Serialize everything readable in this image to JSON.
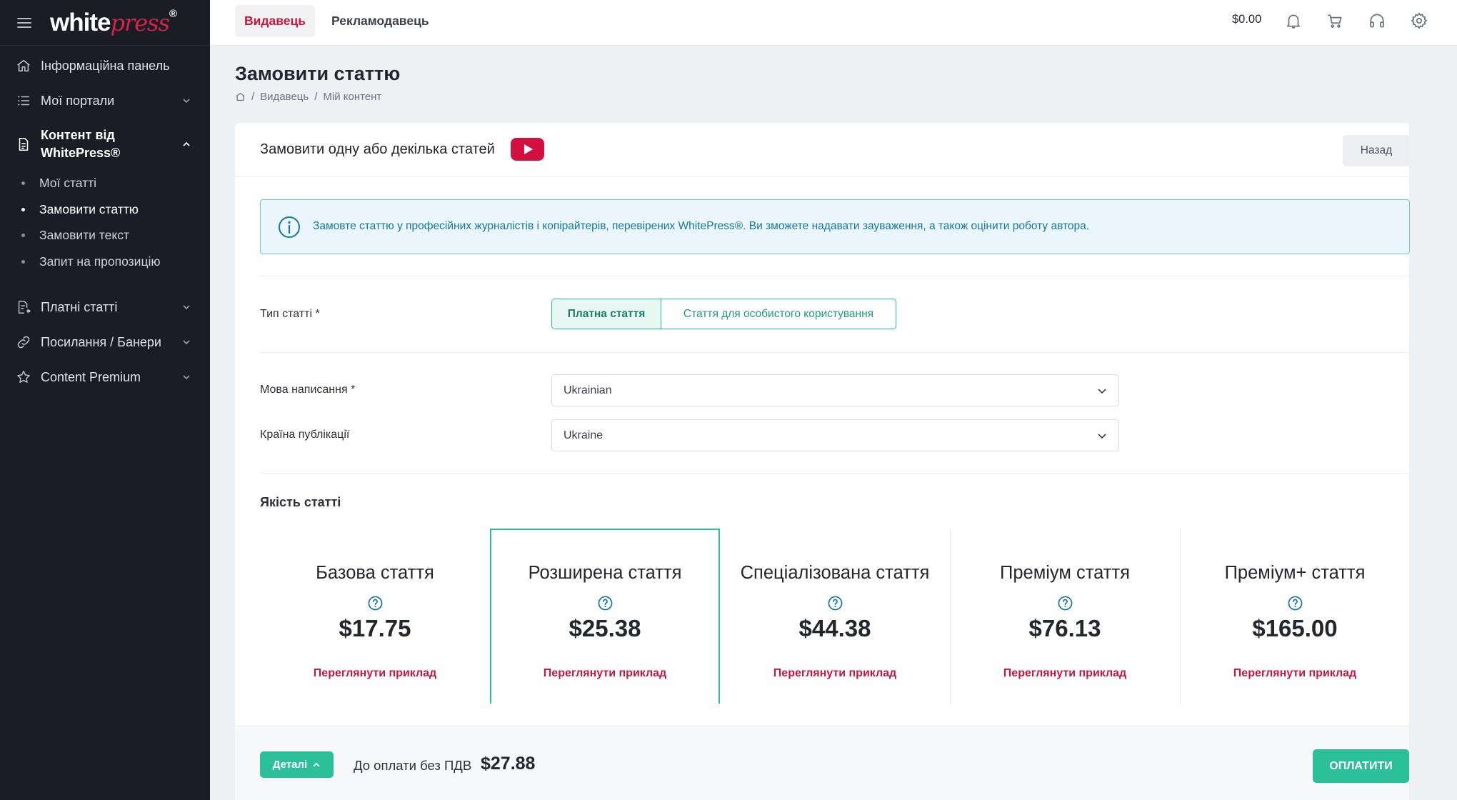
{
  "brand": {
    "white": "white",
    "press": "press",
    "reg": "®"
  },
  "sidebar": {
    "items": [
      {
        "label": "Інформаційна панель",
        "icon": "home-icon"
      },
      {
        "label": "Мої портали",
        "icon": "list-icon"
      },
      {
        "label": "Контент від WhitePress®",
        "icon": "document-icon"
      },
      {
        "label": "Платні статті",
        "icon": "paid-articles-icon"
      },
      {
        "label": "Посилання / Банери",
        "icon": "link-icon"
      },
      {
        "label": "Content Premium",
        "icon": "star-icon"
      }
    ],
    "subitems": [
      "Мої статті",
      "Замовити статтю",
      "Замовити текст",
      "Запит на пропозицію"
    ]
  },
  "topbar": {
    "tab_publisher": "Видавець",
    "tab_advertiser": "Рекламодавець",
    "balance": "$0.00"
  },
  "page": {
    "title": "Замовити статтю",
    "breadcrumb": [
      "Видавець",
      "Мій контент"
    ]
  },
  "card": {
    "title": "Замовити одну або декілька статей",
    "back": "Назад",
    "info": "Замовте статтю у професійних журналістів і копірайтерів, перевірених WhitePress®. Ви зможете надавати зауваження, а також оцінити роботу автора."
  },
  "form": {
    "type_label": "Тип статті *",
    "type_options": [
      "Платна стаття",
      "Стаття для особистого користування"
    ],
    "lang_label": "Мова написання *",
    "lang_value": "Ukrainian",
    "country_label": "Країна публікації",
    "country_value": "Ukraine"
  },
  "quality": {
    "label": "Якість статті",
    "options": [
      {
        "name": "Базова стаття",
        "price": "$17.75",
        "link": "Переглянути приклад"
      },
      {
        "name": "Розширена стаття",
        "price": "$25.38",
        "link": "Переглянути приклад"
      },
      {
        "name": "Спеціалізована стаття",
        "price": "$44.38",
        "link": "Переглянути приклад"
      },
      {
        "name": "Преміум стаття",
        "price": "$76.13",
        "link": "Переглянути приклад"
      },
      {
        "name": "Преміум+ стаття",
        "price": "$165.00",
        "link": "Переглянути приклад"
      }
    ]
  },
  "footer": {
    "details": "Деталі",
    "pay_label": "До оплати без ПДВ",
    "pay_amount": "$27.88",
    "pay_button": "ОПЛАТИТИ"
  },
  "colors": {
    "accent": "#2bc09a",
    "brand": "#c8163d",
    "sidebar": "#1b1d25",
    "info_bg": "#eaf6fb"
  }
}
